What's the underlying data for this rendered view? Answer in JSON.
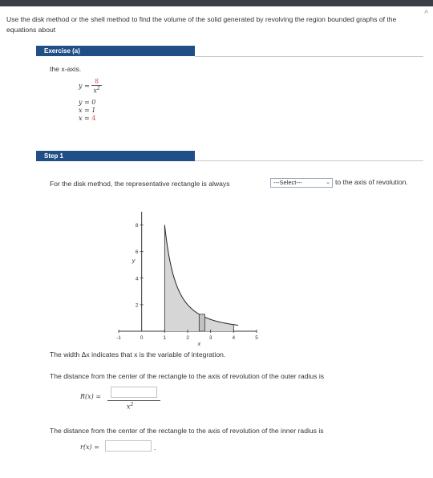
{
  "problem": {
    "text": "Use the disk method or the shell method to find the volume of the solid generated by revolving the region bounded graphs of the equations about"
  },
  "exercise": {
    "header": "Exercise (a)",
    "axis_text": "the x-axis.",
    "eq1_lhs": "y =",
    "eq1_num": "8",
    "eq1_den": "x",
    "eq1_den_exp": "2",
    "eq2": "y = 0",
    "eq3": "x = 1",
    "eq4_lhs": "x =",
    "eq4_val": "4"
  },
  "step1": {
    "header": "Step 1",
    "sentence_start": "For the disk method, the representative rectangle is always",
    "select_value": "---Select---",
    "sentence_end": "to the axis of revolution.",
    "width_text": "The width Δx indicates that x is the variable of integration.",
    "outer_text": "The distance from the center of the rectangle to the axis of revolution of the outer radius is",
    "R_label": "R(x) =",
    "R_den": "x",
    "R_den_exp": "2",
    "inner_text": "The distance from the center of the rectangle to the axis of revolution of the inner radius is",
    "r_label": "r(x) =",
    "r_trailing": "."
  },
  "colors": {
    "section_bar": "#1f4f86",
    "highlight": "#d9534f",
    "region_fill": "#d6d6d6"
  },
  "chart_data": {
    "type": "area",
    "function": "y = 8/x^2",
    "curve": [
      {
        "x": 1,
        "y": 8
      },
      {
        "x": 1.25,
        "y": 5.12
      },
      {
        "x": 1.5,
        "y": 3.56
      },
      {
        "x": 1.75,
        "y": 2.61
      },
      {
        "x": 2,
        "y": 2
      },
      {
        "x": 2.5,
        "y": 1.28
      },
      {
        "x": 3,
        "y": 0.89
      },
      {
        "x": 3.5,
        "y": 0.65
      },
      {
        "x": 4,
        "y": 0.5
      }
    ],
    "shaded_x": [
      1,
      4
    ],
    "rectangle": {
      "x0": 2.5,
      "x1": 2.75
    },
    "xlim": [
      -1,
      5
    ],
    "ylim": [
      0,
      9
    ],
    "x_ticks": [
      "-1",
      "1",
      "2",
      "3",
      "4",
      "5"
    ],
    "x_tick_values": [
      -1,
      1,
      2,
      3,
      4,
      5
    ],
    "y_ticks": [
      "2",
      "4",
      "6",
      "8"
    ],
    "y_tick_values": [
      2,
      4,
      6,
      8
    ],
    "origin_label": "0",
    "xlabel": "x",
    "ylabel": "y"
  }
}
